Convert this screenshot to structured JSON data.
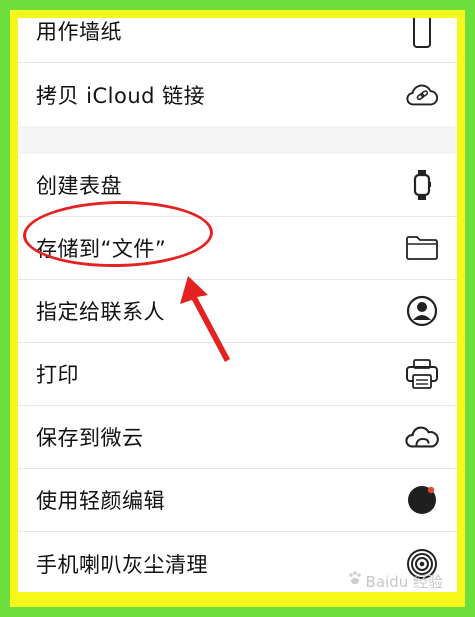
{
  "menu_top": {
    "items": [
      {
        "label": "用作墙纸",
        "icon": "phone-outline-icon"
      },
      {
        "label": "拷贝 iCloud 链接",
        "icon": "icloud-link-icon"
      }
    ]
  },
  "menu_main": {
    "items": [
      {
        "label": "创建表盘",
        "icon": "watch-icon"
      },
      {
        "label": "存储到“文件”",
        "icon": "folder-icon"
      },
      {
        "label": "指定给联系人",
        "icon": "contact-icon"
      },
      {
        "label": "打印",
        "icon": "printer-icon"
      },
      {
        "label": "保存到微云",
        "icon": "weiyun-icon"
      },
      {
        "label": "使用轻颜编辑",
        "icon": "record-dot-icon"
      },
      {
        "label": "手机喇叭灰尘清理",
        "icon": "speaker-rings-icon"
      }
    ]
  },
  "annotation": {
    "highlight_color": "#e52222"
  },
  "watermark": {
    "text": "Baidu 经验"
  },
  "colors": {
    "outer_frame": "#6cdf3d",
    "inner_frame": "#f6f71a",
    "background": "#f5f5f5"
  }
}
